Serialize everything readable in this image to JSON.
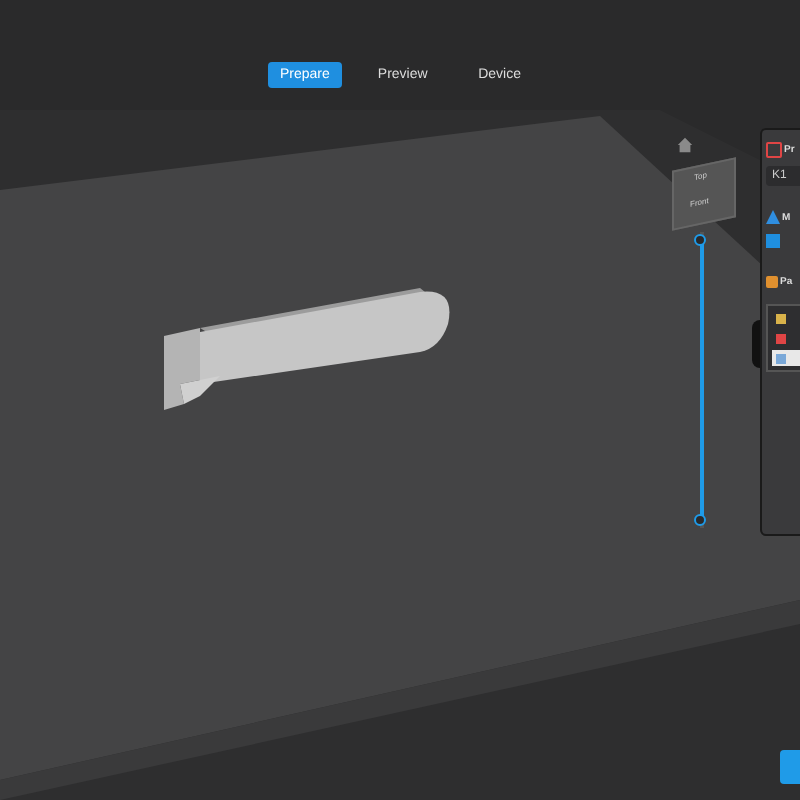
{
  "tabs": [
    {
      "label": "Prepare",
      "selected": true
    },
    {
      "label": "Preview",
      "selected": false
    },
    {
      "label": "Device",
      "selected": false
    }
  ],
  "view_cube": {
    "top": "Top",
    "front": "Front"
  },
  "layer_slider": {
    "level": 1
  },
  "panel": {
    "printer_label": "Pr",
    "printer_value": "K1",
    "material_label": "M",
    "material_checked": true,
    "parts_label": "Pa",
    "parts": [
      {
        "kind": "crown",
        "selected": false
      },
      {
        "kind": "shape",
        "selected": false
      },
      {
        "kind": "shape",
        "selected": true
      }
    ]
  }
}
